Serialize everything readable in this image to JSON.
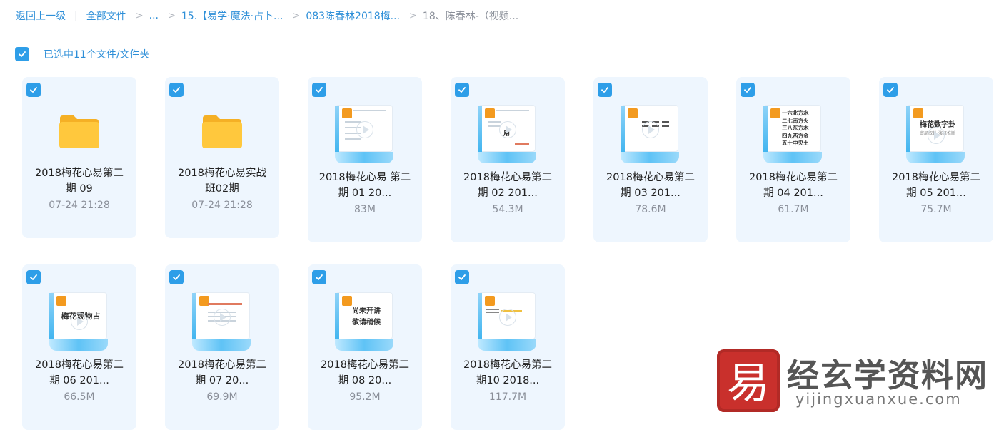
{
  "breadcrumb": {
    "back_label": "返回上一级",
    "divider": "|",
    "items": [
      "全部文件",
      "...",
      "15.【易学·魔法·占卜...",
      "083陈春林2018梅...",
      "18、陈春林-（视频..."
    ],
    "separator": ">"
  },
  "selection": {
    "label": "已选中11个文件/文件夹",
    "checked": true
  },
  "files": [
    {
      "type": "folder",
      "name_line1": "2018梅花心易第二",
      "name_line2": "期 09",
      "meta": "07-24 21:28"
    },
    {
      "type": "folder",
      "name_line1": "2018梅花心易实战",
      "name_line2": "班02期",
      "meta": "07-24 21:28"
    },
    {
      "type": "video",
      "name_line1": "2018梅花心易 第二",
      "name_line2": "期 01 20...",
      "meta": "83M"
    },
    {
      "type": "video",
      "name_line1": "2018梅花心易第二",
      "name_line2": "期 02 201...",
      "meta": "54.3M"
    },
    {
      "type": "video",
      "name_line1": "2018梅花心易第二",
      "name_line2": "期 03 201...",
      "meta": "78.6M"
    },
    {
      "type": "video",
      "name_line1": "2018梅花心易第二",
      "name_line2": "期 04 201...",
      "meta": "61.7M"
    },
    {
      "type": "video",
      "name_line1": "2018梅花心易第二",
      "name_line2": "期 05 201...",
      "meta": "75.7M"
    },
    {
      "type": "video",
      "name_line1": "2018梅花心易第二",
      "name_line2": "期 06 201...",
      "meta": "66.5M"
    },
    {
      "type": "video",
      "name_line1": "2018梅花心易第二",
      "name_line2": "期 07 20...",
      "meta": "69.9M"
    },
    {
      "type": "video",
      "name_line1": "2018梅花心易第二",
      "name_line2": "期 08 20...",
      "meta": "95.2M"
    },
    {
      "type": "video",
      "name_line1": "2018梅花心易第二",
      "name_line2": "期10 2018...",
      "meta": "117.7M"
    }
  ],
  "thumb_text": {
    "t05": "梅花数字卦",
    "t05_sub": "审局取卦 演绎推断",
    "t06": "梅花观物占",
    "t08_line1": "尚未开讲",
    "t08_line2": "敬请稍候",
    "t04_lines": [
      "一六北方水",
      "二七南方火",
      "三八东方木",
      "四九西方金",
      "五十中央土"
    ],
    "t02_char": "用"
  },
  "watermark": {
    "seal_char": "易",
    "title": "经玄学资料网",
    "url": "yijingxuanxue.com"
  },
  "colors": {
    "accent": "#2e8fd8",
    "check": "#2e9ee8",
    "card_bg": "#eef6fe",
    "folder": "#ffc83d",
    "seal": "#c9302c"
  },
  "icons": {
    "checkbox": "check-icon",
    "folder": "folder-icon",
    "play": "play-icon"
  }
}
